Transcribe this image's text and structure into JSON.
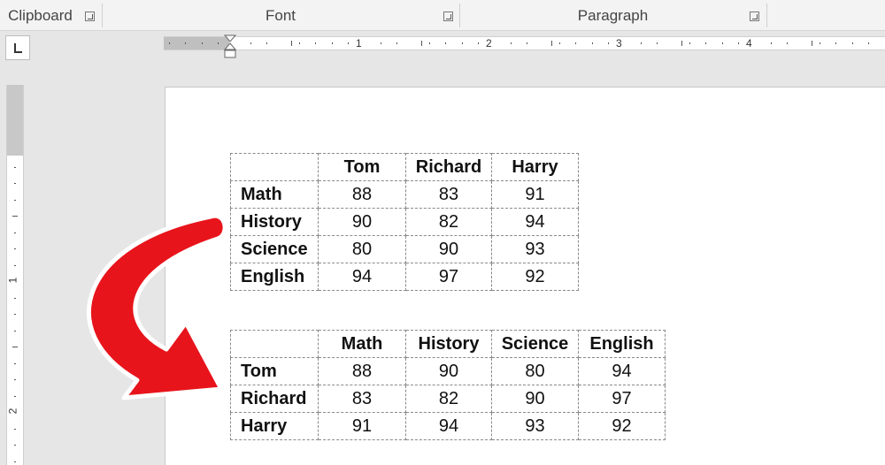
{
  "ribbon": {
    "groups": [
      {
        "label": "Clipboard"
      },
      {
        "label": "Font"
      },
      {
        "label": "Paragraph"
      }
    ]
  },
  "ruler": {
    "horizontal_numbers": [
      "1",
      "2",
      "3",
      "4"
    ],
    "vertical_numbers": [
      "1",
      "2"
    ]
  },
  "table1": {
    "headers": [
      "",
      "Tom",
      "Richard",
      "Harry"
    ],
    "rows": [
      {
        "label": "Math",
        "values": [
          "88",
          "83",
          "91"
        ]
      },
      {
        "label": "History",
        "values": [
          "90",
          "82",
          "94"
        ]
      },
      {
        "label": "Science",
        "values": [
          "80",
          "90",
          "93"
        ]
      },
      {
        "label": "English",
        "values": [
          "94",
          "97",
          "92"
        ]
      }
    ]
  },
  "table2": {
    "headers": [
      "",
      "Math",
      "History",
      "Science",
      "English"
    ],
    "rows": [
      {
        "label": "Tom",
        "values": [
          "88",
          "90",
          "80",
          "94"
        ]
      },
      {
        "label": "Richard",
        "values": [
          "83",
          "82",
          "90",
          "97"
        ]
      },
      {
        "label": "Harry",
        "values": [
          "91",
          "94",
          "93",
          "92"
        ]
      }
    ]
  },
  "colors": {
    "arrow": "#e8141b",
    "arrow_outline": "#ffffff"
  }
}
